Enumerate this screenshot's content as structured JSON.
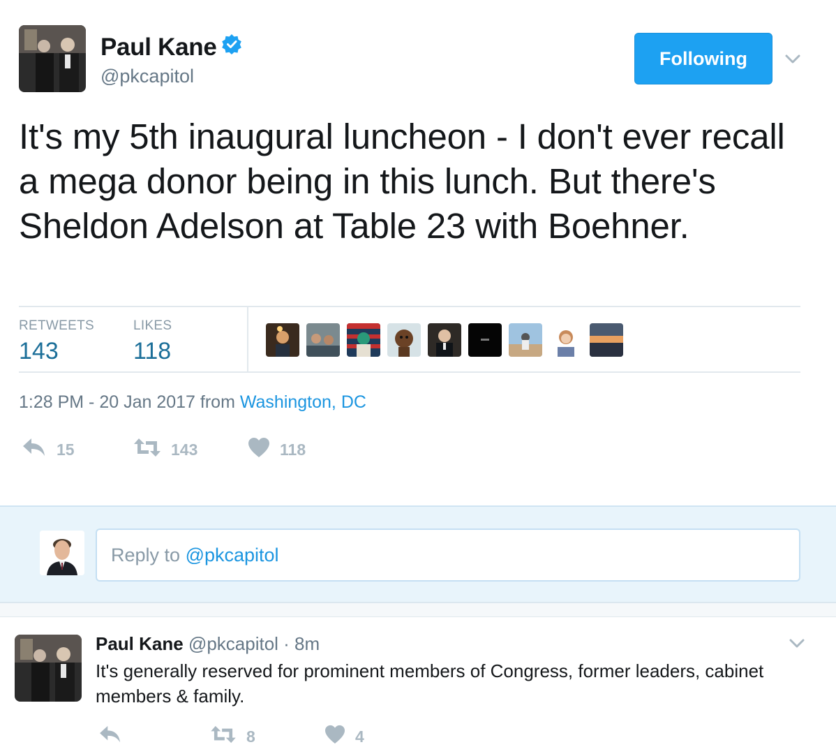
{
  "tweet": {
    "name": "Paul Kane",
    "handle": "@pkcapitol",
    "follow_label": "Following",
    "text": "It's my 5th inaugural luncheon - I don't ever recall a mega donor being in this lunch. But there's Sheldon Adelson at Table 23 with Boehner.",
    "stats": {
      "retweets_label": "RETWEETS",
      "retweets_value": "143",
      "likes_label": "LIKES",
      "likes_value": "118"
    },
    "time": "1:28 PM - 20 Jan 2017 from ",
    "location": "Washington, DC",
    "actions": {
      "replies": "15",
      "retweets": "143",
      "likes": "118"
    }
  },
  "reply_box": {
    "prefix": "Reply to ",
    "mention": "@pkcapitol"
  },
  "reply_tweet": {
    "name": "Paul Kane",
    "meta": " @pkcapitol · 8m",
    "text": "It's generally reserved for prominent members of Congress, former leaders, cabinet members & family.",
    "actions": {
      "retweets": "8",
      "likes": "4"
    }
  },
  "colors": {
    "accent": "#1da1f2",
    "link": "#1b95e0",
    "muted": "#657786",
    "action_gray": "#aab8c2"
  }
}
